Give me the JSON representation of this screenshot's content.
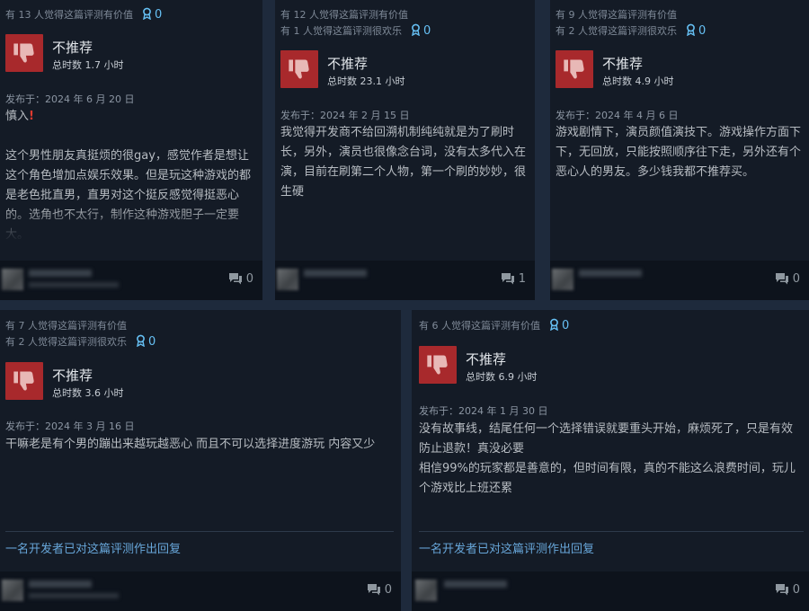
{
  "colors": {
    "thumb_bg": "#a8292c",
    "accent": "#66c0f4",
    "dev_reply": "#67a6d9",
    "warning": "#e03a2f"
  },
  "icons": {
    "verdict": "thumbs-down-icon",
    "award": "award-ribbon-icon",
    "comment": "comment-bubble-icon"
  },
  "reviews": [
    {
      "helpful": "有 13 人觉得这篇评测有价值",
      "funny": "",
      "award_count": "0",
      "verdict": "不推荐",
      "hours": "总时数 1.7 小时",
      "posted": "发布于：2024 年 6 月 20 日",
      "body_first": "慎入",
      "body_first_mark": "!",
      "body": "这个男性朋友真挺烦的很gay，感觉作者是想让这个角色增加点娱乐效果。但是玩这种游戏的都是老色批直男，直男对这个挺反感觉得挺恶心的。选角也不太行，制作这种游戏胆子一定要大。",
      "dev_reply": "",
      "comment_count": "0"
    },
    {
      "helpful": "有 12 人觉得这篇评测有价值",
      "funny": "有 1 人觉得这篇评测很欢乐",
      "award_count": "0",
      "verdict": "不推荐",
      "hours": "总时数 23.1 小时",
      "posted": "发布于：2024 年 2 月 15 日",
      "body": "我觉得开发商不给回溯机制纯纯就是为了刷时长，另外，演员也很像念台词，没有太多代入在演，目前在刷第二个人物，第一个刷的妙妙，很生硬",
      "dev_reply": "",
      "comment_count": "1"
    },
    {
      "helpful": "有 9 人觉得这篇评测有价值",
      "funny": "有 2 人觉得这篇评测很欢乐",
      "award_count": "0",
      "verdict": "不推荐",
      "hours": "总时数 4.9 小时",
      "posted": "发布于：2024 年 4 月 6 日",
      "body": "游戏剧情下，演员颜值演技下。游戏操作方面下下，无回放，只能按照顺序往下走，另外还有个恶心人的男友。多少钱我都不推荐买。",
      "dev_reply": "",
      "comment_count": "0"
    },
    {
      "helpful": "有 7 人觉得这篇评测有价值",
      "funny": "有 2 人觉得这篇评测很欢乐",
      "award_count": "0",
      "verdict": "不推荐",
      "hours": "总时数 3.6 小时",
      "posted": "发布于：2024 年 3 月 16 日",
      "body": "干嘛老是有个男的蹦出来越玩越恶心 而且不可以选择进度游玩 内容又少",
      "dev_reply": "一名开发者已对这篇评测作出回复",
      "comment_count": "0"
    },
    {
      "helpful": "有 6 人觉得这篇评测有价值",
      "funny": "",
      "award_count": "0",
      "verdict": "不推荐",
      "hours": "总时数 6.9 小时",
      "posted": "发布于：2024 年 1 月 30 日",
      "body": "没有故事线，结尾任何一个选择错误就要重头开始，麻烦死了，只是有效防止退款！真没必要\n相信99%的玩家都是善意的，但时间有限，真的不能这么浪费时间，玩儿个游戏比上班还累",
      "dev_reply": "一名开发者已对这篇评测作出回复",
      "comment_count": "0"
    }
  ]
}
